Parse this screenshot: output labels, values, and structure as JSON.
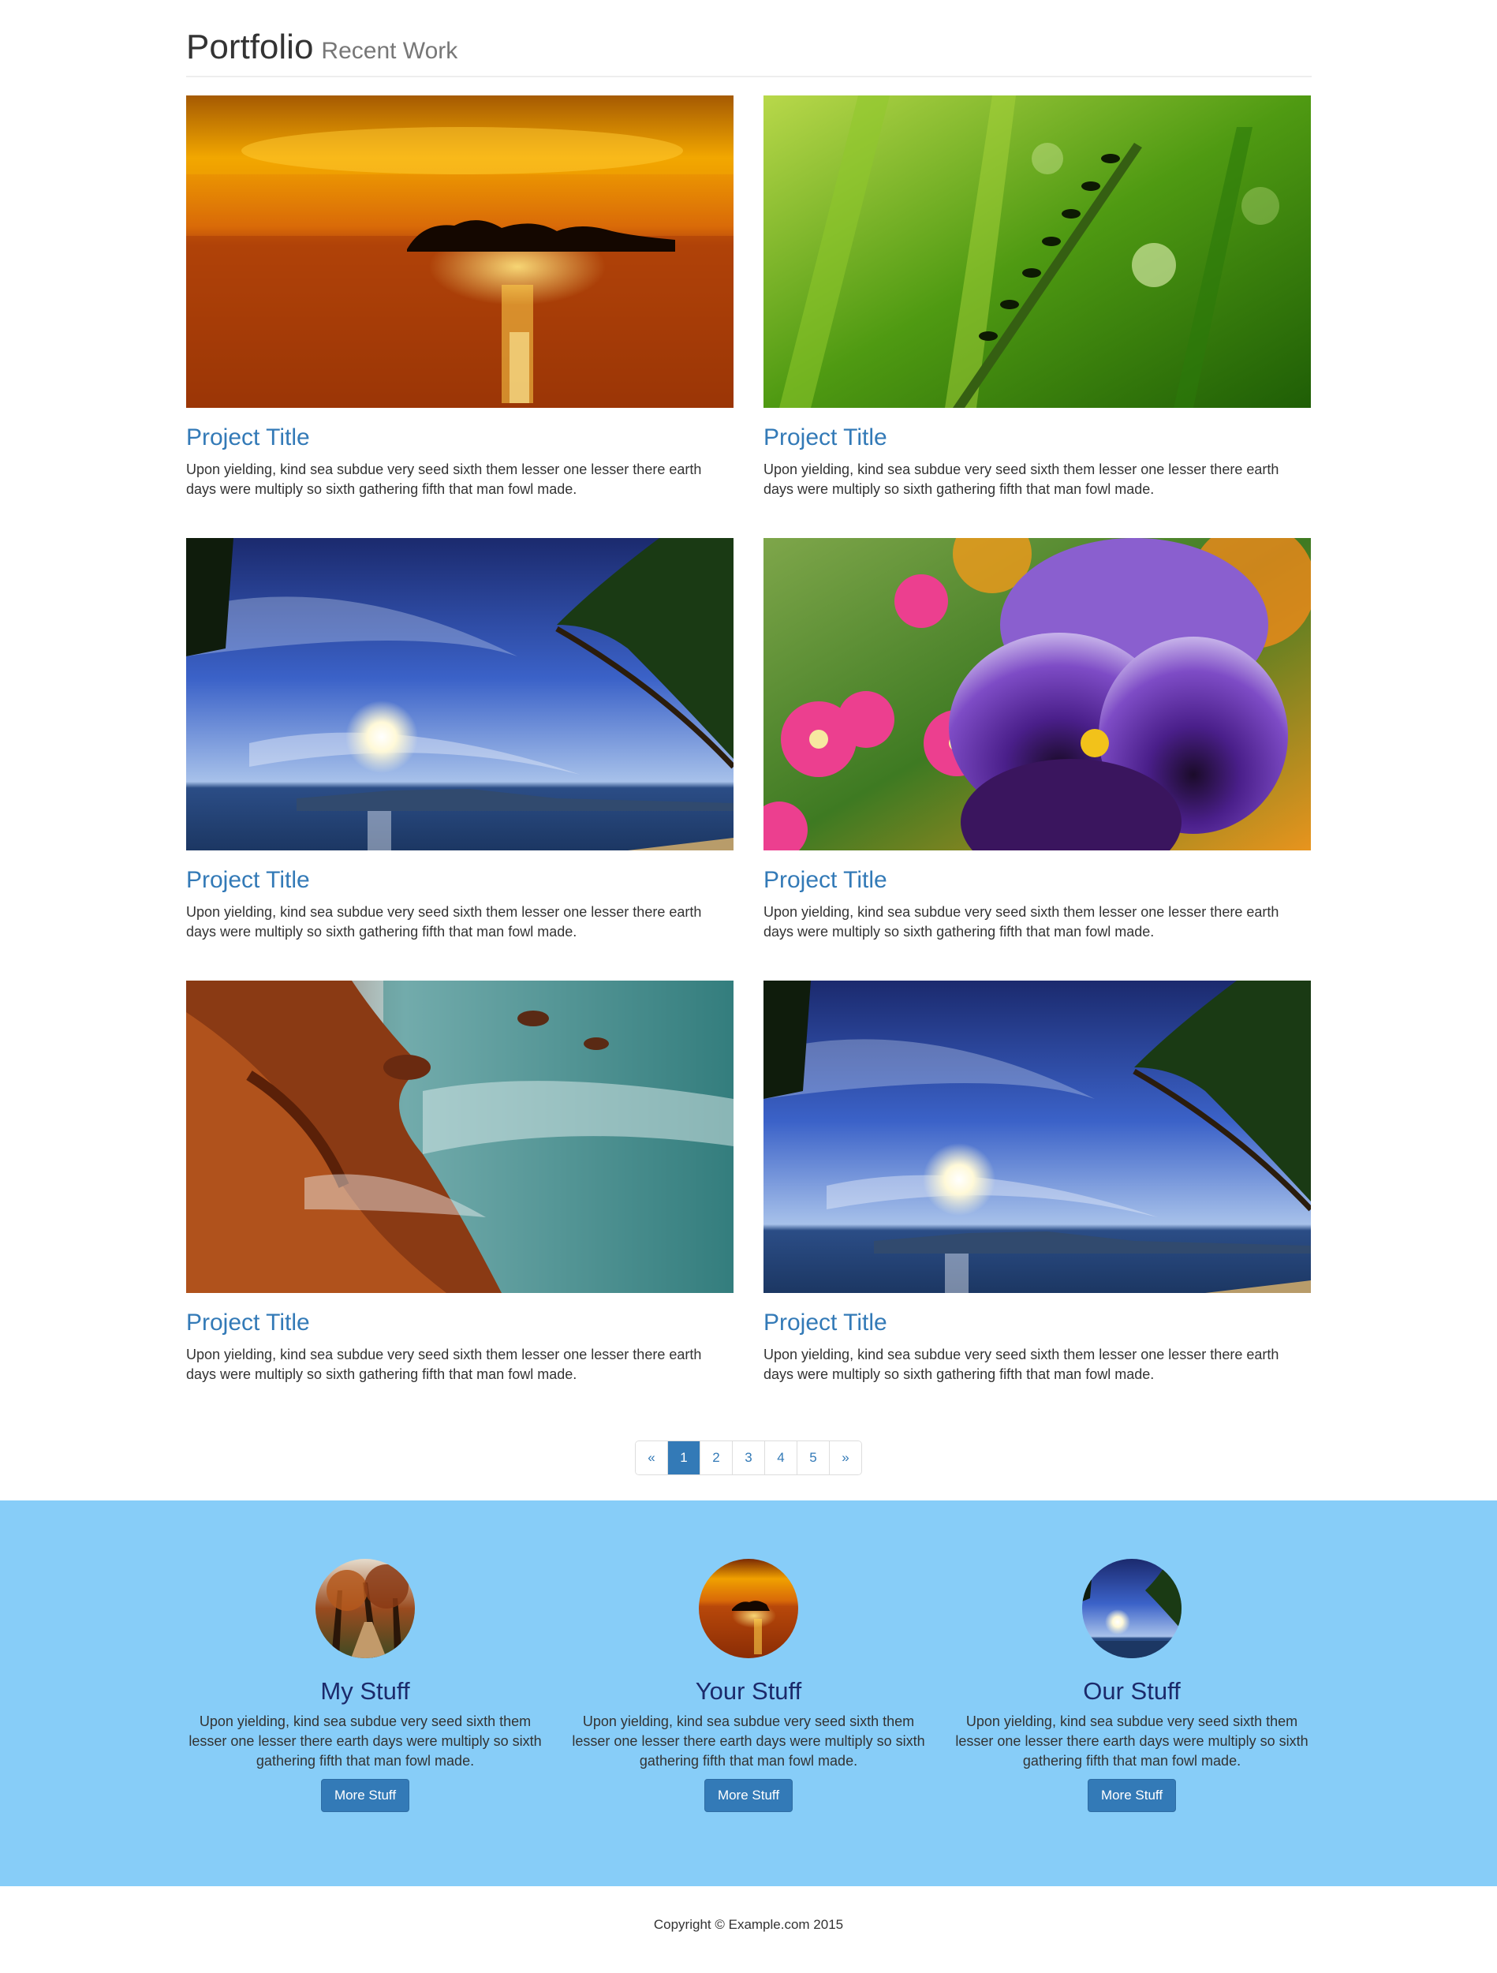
{
  "header": {
    "title": "Portfolio",
    "subtitle": "Recent Work"
  },
  "projects": [
    {
      "title": "Project Title",
      "description": "Upon yielding, kind sea subdue very seed sixth them lesser one lesser there earth days were multiply so sixth gathering fifth that man fowl made.",
      "image": "sunset-island-photo"
    },
    {
      "title": "Project Title",
      "description": "Upon yielding, kind sea subdue very seed sixth them lesser one lesser there earth days were multiply so sixth gathering fifth that man fowl made.",
      "image": "ants-on-grass-photo"
    },
    {
      "title": "Project Title",
      "description": "Upon yielding, kind sea subdue very seed sixth them lesser one lesser there earth days were multiply so sixth gathering fifth that man fowl made.",
      "image": "tropical-beach-sky-photo"
    },
    {
      "title": "Project Title",
      "description": "Upon yielding, kind sea subdue very seed sixth them lesser one lesser there earth days were multiply so sixth gathering fifth that man fowl made.",
      "image": "pansy-flower-photo"
    },
    {
      "title": "Project Title",
      "description": "Upon yielding, kind sea subdue very seed sixth them lesser one lesser there earth days were multiply so sixth gathering fifth that man fowl made.",
      "image": "rocky-coast-photo"
    },
    {
      "title": "Project Title",
      "description": "Upon yielding, kind sea subdue very seed sixth them lesser one lesser there earth days were multiply so sixth gathering fifth that man fowl made.",
      "image": "tropical-beach-sky-photo"
    }
  ],
  "pagination": {
    "prev": "«",
    "pages": [
      "1",
      "2",
      "3",
      "4",
      "5"
    ],
    "active": "1",
    "next": "»"
  },
  "features": [
    {
      "title": "My Stuff",
      "description": "Upon yielding, kind sea subdue very seed sixth them lesser one lesser there earth days were multiply so sixth gathering fifth that man fowl made.",
      "button": "More Stuff",
      "image": "autumn-trees-photo"
    },
    {
      "title": "Your Stuff",
      "description": "Upon yielding, kind sea subdue very seed sixth them lesser one lesser there earth days were multiply so sixth gathering fifth that man fowl made.",
      "button": "More Stuff",
      "image": "sunset-island-photo"
    },
    {
      "title": "Our Stuff",
      "description": "Upon yielding, kind sea subdue very seed sixth them lesser one lesser there earth days were multiply so sixth gathering fifth that man fowl made.",
      "button": "More Stuff",
      "image": "tropical-beach-sky-photo"
    }
  ],
  "footer": {
    "copyright": "Copyright © Example.com 2015"
  },
  "colors": {
    "link": "#337ab7",
    "band_background": "#87cdf8",
    "feature_heading": "#1c2a6b"
  }
}
